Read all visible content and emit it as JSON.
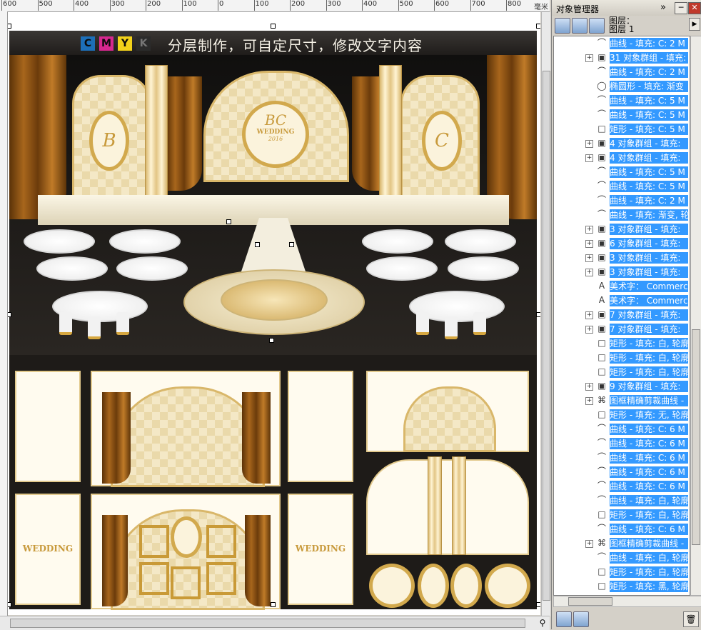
{
  "ruler": {
    "units": "毫米",
    "ticks": [
      "600",
      "500",
      "400",
      "300",
      "200",
      "100",
      "0",
      "100",
      "200",
      "300",
      "400",
      "500",
      "600",
      "700",
      "800"
    ]
  },
  "canvas": {
    "banner_cmyk": [
      "C",
      "M",
      "Y",
      "K"
    ],
    "banner_colors": [
      "#1d6fb8",
      "#d6278f",
      "#f2d21a",
      "#2b2b2b"
    ],
    "banner_text": "分层制作，可自定尺寸，修改文字内容",
    "monogram_left": "B",
    "monogram_right": "C",
    "monogram_center": "BC",
    "center_wedding": "WEDDING",
    "center_date": "2016",
    "panel_wedding_left": "WEDDING",
    "panel_wedding_right": "WEDDING"
  },
  "docker": {
    "title": "对象管理器",
    "layer_label_1": "图层：",
    "layer_label_2": "图层 1",
    "colors": {
      "selection": "#3399ff"
    },
    "rows": [
      {
        "icon": "curve-icon",
        "expand": false,
        "text": "曲线 - 填充: C: 2 M"
      },
      {
        "icon": "group-icon",
        "expand": true,
        "text": "31 对象群组 - 填充:"
      },
      {
        "icon": "curve-icon",
        "expand": false,
        "text": "曲线 - 填充: C: 2 M"
      },
      {
        "icon": "ellipse-icon",
        "expand": false,
        "text": "椭圆形 - 填充: 渐变"
      },
      {
        "icon": "curve-icon",
        "expand": false,
        "text": "曲线 - 填充: C: 5 M"
      },
      {
        "icon": "curve-icon",
        "expand": false,
        "text": "曲线 - 填充: C: 5 M"
      },
      {
        "icon": "rectangle-icon",
        "expand": false,
        "text": "矩形 - 填充: C: 5 M"
      },
      {
        "icon": "group-icon",
        "expand": true,
        "text": "4 对象群组 - 填充:"
      },
      {
        "icon": "group-icon",
        "expand": true,
        "text": "4 对象群组 - 填充:"
      },
      {
        "icon": "curve-icon",
        "expand": false,
        "text": "曲线 - 填充: C: 5 M"
      },
      {
        "icon": "curve-icon",
        "expand": false,
        "text": "曲线 - 填充: C: 5 M"
      },
      {
        "icon": "curve-icon",
        "expand": false,
        "text": "曲线 - 填充: C: 2 M"
      },
      {
        "icon": "curve-icon",
        "expand": false,
        "text": "曲线 - 填充: 渐变, 轮"
      },
      {
        "icon": "group-icon",
        "expand": true,
        "text": "3 对象群组 - 填充:"
      },
      {
        "icon": "group-icon",
        "expand": true,
        "text": "6 对象群组 - 填充:"
      },
      {
        "icon": "group-icon",
        "expand": true,
        "text": "3 对象群组 - 填充:"
      },
      {
        "icon": "group-icon",
        "expand": true,
        "text": "3 对象群组 - 填充:"
      },
      {
        "icon": "artistic-text-icon",
        "expand": false,
        "text": "美术字： Commerc"
      },
      {
        "icon": "artistic-text-icon",
        "expand": false,
        "text": "美术字： Commerc"
      },
      {
        "icon": "group-icon",
        "expand": true,
        "text": "7 对象群组 - 填充:"
      },
      {
        "icon": "group-icon",
        "expand": true,
        "text": "7 对象群组 - 填充:"
      },
      {
        "icon": "rectangle-icon",
        "expand": false,
        "text": "矩形 - 填充: 白, 轮廓"
      },
      {
        "icon": "rectangle-icon",
        "expand": false,
        "text": "矩形 - 填充: 白, 轮廓"
      },
      {
        "icon": "rectangle-icon",
        "expand": false,
        "text": "矩形 - 填充: 白, 轮廓"
      },
      {
        "icon": "group-icon",
        "expand": true,
        "text": "9 对象群组 - 填充:"
      },
      {
        "icon": "powerclip-icon",
        "expand": true,
        "text": "图框精确剪裁曲线 -"
      },
      {
        "icon": "rectangle-icon",
        "expand": false,
        "text": "矩形 - 填充: 无, 轮廓"
      },
      {
        "icon": "curve-icon",
        "expand": false,
        "text": "曲线 - 填充: C: 6 M"
      },
      {
        "icon": "curve-icon",
        "expand": false,
        "text": "曲线 - 填充: C: 6 M"
      },
      {
        "icon": "curve-icon",
        "expand": false,
        "text": "曲线 - 填充: C: 6 M"
      },
      {
        "icon": "curve-icon",
        "expand": false,
        "text": "曲线 - 填充: C: 6 M"
      },
      {
        "icon": "curve-icon",
        "expand": false,
        "text": "曲线 - 填充: C: 6 M"
      },
      {
        "icon": "curve-icon",
        "expand": false,
        "text": "曲线 - 填充: 白, 轮廓"
      },
      {
        "icon": "rectangle-icon",
        "expand": false,
        "text": "矩形 - 填充: 白, 轮廓"
      },
      {
        "icon": "curve-icon",
        "expand": false,
        "text": "曲线 - 填充: C: 6 M"
      },
      {
        "icon": "powerclip-icon",
        "expand": true,
        "text": "图框精确剪裁曲线 -"
      },
      {
        "icon": "curve-icon",
        "expand": false,
        "text": "曲线 - 填充: 白, 轮廓"
      },
      {
        "icon": "rectangle-icon",
        "expand": false,
        "text": "矩形 - 填充: 白, 轮廓"
      },
      {
        "icon": "rectangle-icon",
        "expand": false,
        "text": "矩形 - 填充: 黑, 轮廓"
      }
    ]
  }
}
